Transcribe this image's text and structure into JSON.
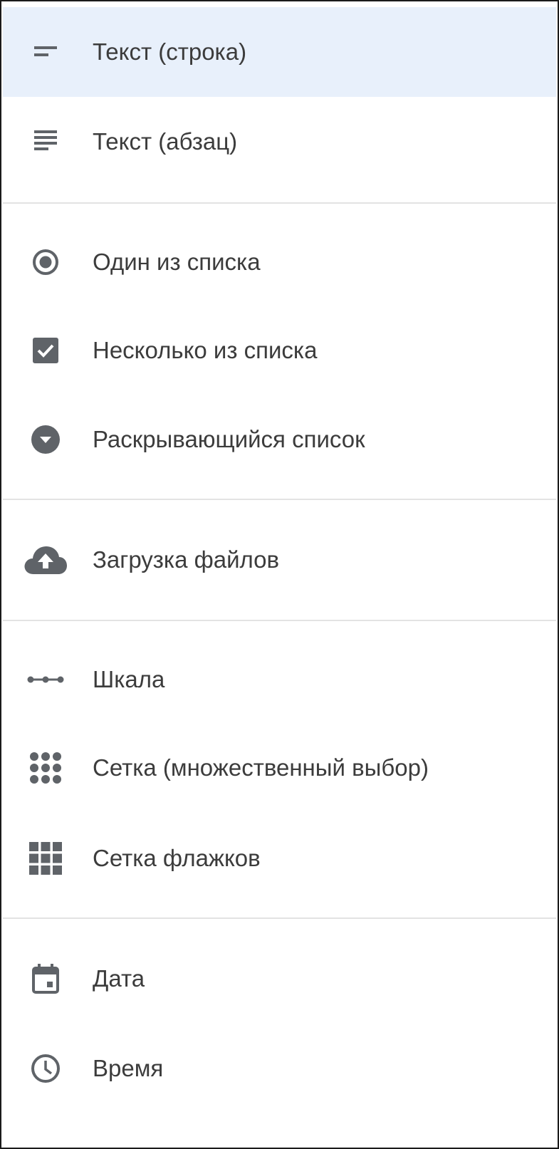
{
  "menu": {
    "items": [
      {
        "label": "Текст (строка)",
        "icon": "short-text-icon",
        "selected": true
      },
      {
        "label": "Текст (абзац)",
        "icon": "paragraph-icon"
      },
      {
        "label": "Один из списка",
        "icon": "radio-button-icon"
      },
      {
        "label": "Несколько из списка",
        "icon": "checkbox-icon"
      },
      {
        "label": "Раскрывающийся список",
        "icon": "dropdown-icon"
      },
      {
        "label": "Загрузка файлов",
        "icon": "cloud-upload-icon"
      },
      {
        "label": "Шкала",
        "icon": "linear-scale-icon"
      },
      {
        "label": "Сетка (множественный выбор)",
        "icon": "radio-grid-icon"
      },
      {
        "label": "Сетка флажков",
        "icon": "checkbox-grid-icon"
      },
      {
        "label": "Дата",
        "icon": "calendar-icon"
      },
      {
        "label": "Время",
        "icon": "clock-icon"
      }
    ]
  },
  "colors": {
    "icon": "#5f6368",
    "text": "#3c3c3c",
    "selected_bg": "#e8f0fb",
    "divider": "#e3e3e3"
  }
}
